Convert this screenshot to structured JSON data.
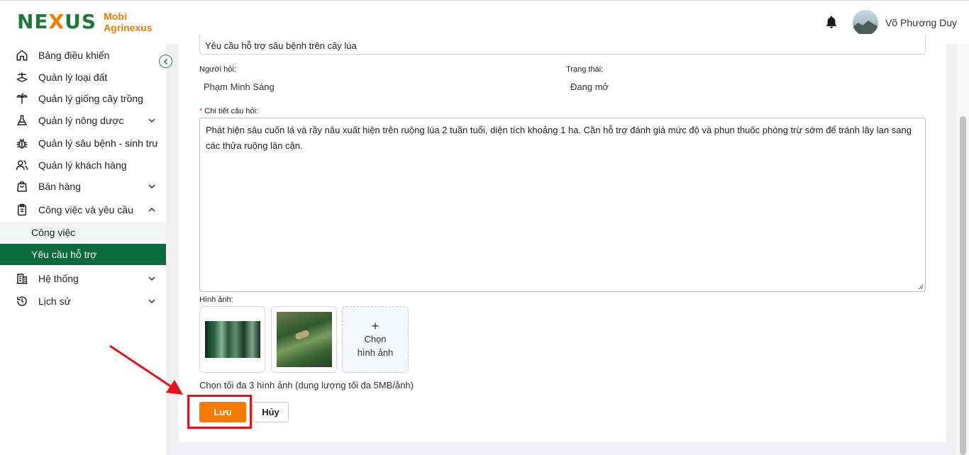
{
  "brand": {
    "logo_mark": "NEXUS",
    "line1": "Mobi",
    "line2": "Agrinexus"
  },
  "header": {
    "user_name": "Võ Phương Duy",
    "icons": [
      "bell-icon",
      "avatar"
    ]
  },
  "sidebar": {
    "items": [
      {
        "label": "Bảng điều khiển",
        "icon": "home-icon"
      },
      {
        "label": "Quản lý loại đất",
        "icon": "soil-icon"
      },
      {
        "label": "Quản lý giống cây trồng",
        "icon": "plant-icon"
      },
      {
        "label": "Quản lý nông dược",
        "icon": "flask-icon",
        "expandable": true
      },
      {
        "label": "Quản lý sâu bệnh - sinh trưởng",
        "icon": "bug-icon"
      },
      {
        "label": "Quản lý khách hàng",
        "icon": "users-icon"
      },
      {
        "label": "Bán hàng",
        "icon": "bag-icon",
        "expandable": true
      },
      {
        "label": "Công việc và yêu cầu",
        "icon": "clipboard-icon",
        "expandable": true,
        "expanded": true
      },
      {
        "label": "Hệ thống",
        "icon": "building-icon",
        "expandable": true
      },
      {
        "label": "Lịch sử",
        "icon": "history-icon",
        "expandable": true
      }
    ],
    "sub_items": [
      {
        "label": "Công việc",
        "active": false
      },
      {
        "label": "Yêu cầu hỗ trợ",
        "active": true
      }
    ]
  },
  "form": {
    "title_value": "Yêu cầu hỗ trợ sâu bệnh trên cây lúa",
    "requester_label": "Người hỏi:",
    "requester_value": "Phạm Minh Sáng",
    "status_label": "Trạng thái:",
    "status_value": "Đang mở",
    "detail_required_mark": "*",
    "detail_label": "Chi tiết câu hỏi:",
    "detail_value": "Phát hiện sâu cuốn lá và rầy nâu xuất hiện trên ruộng lúa 2 tuần tuổi, diện tích khoảng 1 ha. Cần hỗ trợ đánh giá mức độ và phun thuốc phòng trừ sớm để tránh lây lan sang các thửa ruộng lân cận.",
    "images_label": "Hình ảnh:",
    "add_image_plus": "+",
    "add_image_line1": "Chọn",
    "add_image_line2": "hình ảnh",
    "hint": "Chọn tối đa 3 hình ảnh (dung lượng tối đa 5MB/ảnh)",
    "save_label": "Lưu",
    "cancel_label": "Hủy"
  },
  "colors": {
    "brand_green": "#0b6b3a",
    "brand_orange": "#f47b00",
    "annotation_red": "#e8111b"
  }
}
